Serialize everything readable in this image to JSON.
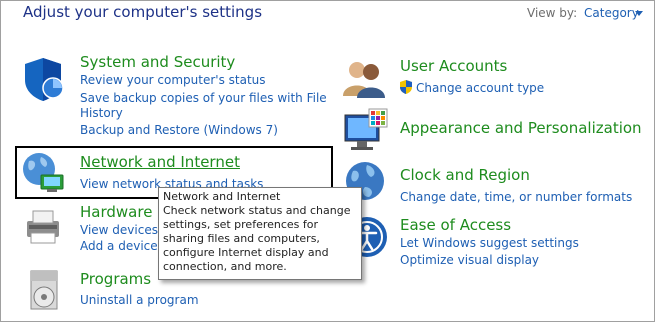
{
  "header": {
    "title": "Adjust your computer's settings",
    "view_by_label": "View by:",
    "view_by_value": "Category"
  },
  "categories": {
    "system_security": {
      "title": "System and Security",
      "links": [
        "Review your computer's status",
        "Save backup copies of your files with File",
        "History",
        "Backup and Restore (Windows 7)"
      ]
    },
    "network_internet": {
      "title": "Network and Internet",
      "links": [
        "View network status and tasks"
      ]
    },
    "hardware_sound": {
      "title": "Hardware a",
      "links": [
        "View devices a",
        "Add a device"
      ]
    },
    "programs": {
      "title": "Programs",
      "links": [
        "Uninstall a program"
      ]
    },
    "user_accounts": {
      "title": "User Accounts",
      "links": [
        "Change account type"
      ]
    },
    "appearance": {
      "title": "Appearance and Personalization",
      "links": []
    },
    "clock_region": {
      "title": "Clock and Region",
      "links": [
        "Change date, time, or number formats"
      ]
    },
    "ease_of_access": {
      "title": "Ease of Access",
      "links": [
        "Let Windows suggest settings",
        "Optimize visual display"
      ]
    }
  },
  "tooltip": {
    "title": "Network and Internet",
    "body": "Check network status and change settings, set preferences for sharing files and computers, configure Internet display and connection, and more."
  },
  "colors": {
    "category_title": "#1e8c1e",
    "link": "#1e5fb3",
    "header": "#1e3287"
  },
  "icons": {
    "system_security": "shield-icon",
    "network_internet": "globe-network-icon",
    "hardware_sound": "printer-icon",
    "programs": "programs-disc-icon",
    "user_accounts": "users-icon",
    "uac": "uac-shield-icon",
    "appearance": "monitor-palette-icon",
    "clock_region": "globe-clock-icon",
    "ease_of_access": "ease-access-icon"
  }
}
